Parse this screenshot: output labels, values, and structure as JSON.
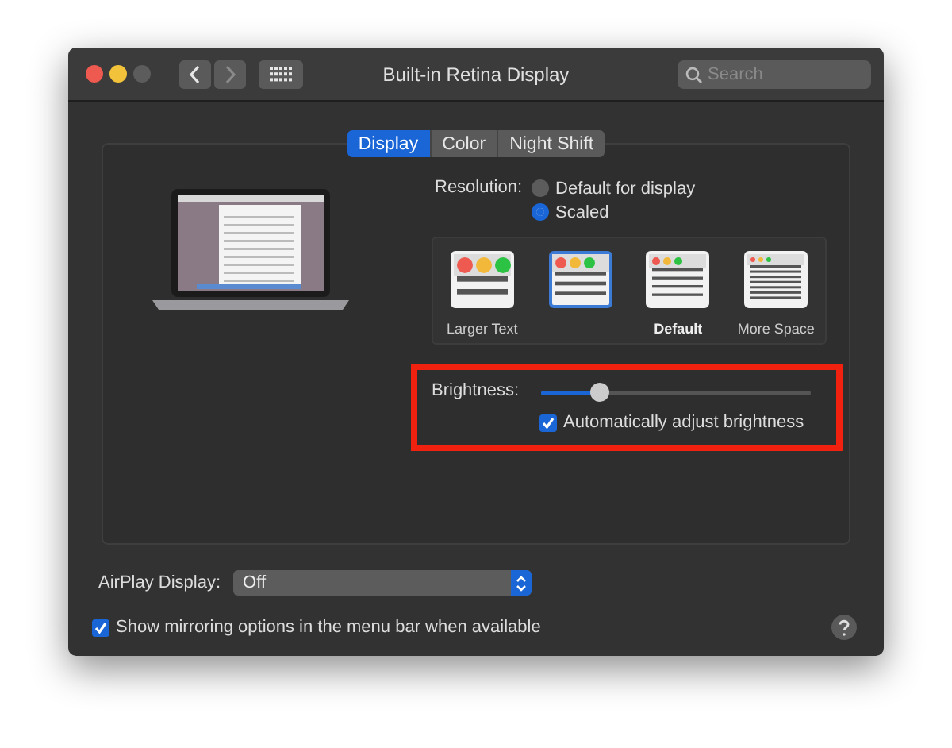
{
  "window": {
    "title": "Built-in Retina Display",
    "search_placeholder": "Search"
  },
  "tabs": [
    {
      "label": "Display",
      "selected": true
    },
    {
      "label": "Color",
      "selected": false
    },
    {
      "label": "Night Shift",
      "selected": false
    }
  ],
  "resolution": {
    "label": "Resolution:",
    "options": [
      {
        "label": "Default for display",
        "selected": false
      },
      {
        "label": "Scaled",
        "selected": true
      }
    ]
  },
  "scales": [
    {
      "kind": "larger",
      "label": "Larger Text",
      "selected": false,
      "bold": false
    },
    {
      "kind": "large",
      "selected": true
    },
    {
      "kind": "default",
      "label": "Default",
      "selected": false,
      "bold": true
    },
    {
      "kind": "more",
      "label": "More Space",
      "selected": false,
      "bold": false
    }
  ],
  "brightness": {
    "label": "Brightness:",
    "level": 0.22,
    "highlighted": true,
    "auto": {
      "label": "Automatically adjust brightness",
      "checked": true
    }
  },
  "airplay": {
    "label": "AirPlay Display:",
    "value": "Off"
  },
  "mirroring": {
    "label": "Show mirroring options in the menu bar when available",
    "checked": true
  }
}
